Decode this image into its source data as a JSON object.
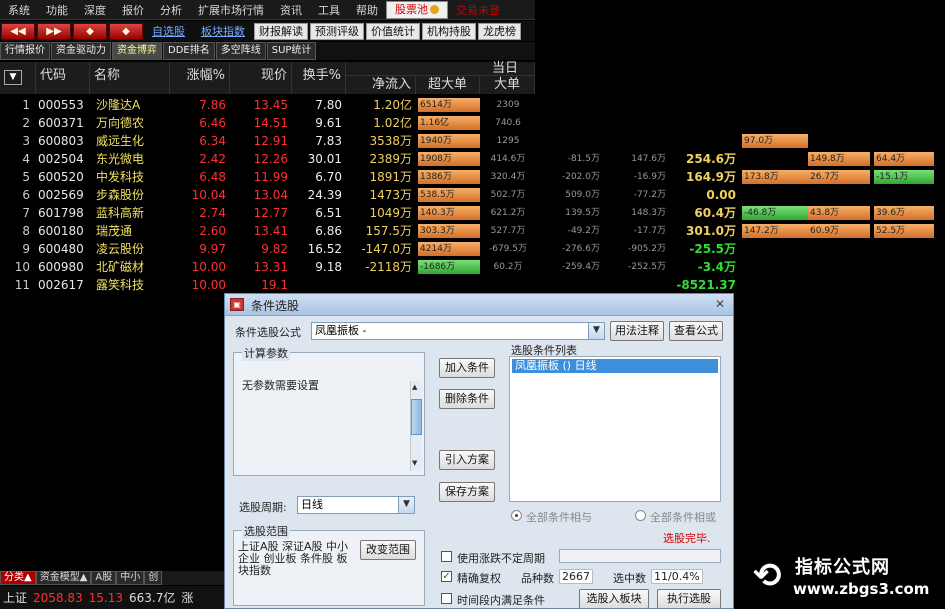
{
  "menubar": {
    "items": [
      "系统",
      "功能",
      "深度",
      "报价",
      "分析",
      "扩展市场行情",
      "资讯",
      "工具",
      "帮助"
    ],
    "highlight": "股票池",
    "extra": "交易未登"
  },
  "toolbar": {
    "nav": [
      "◀◀",
      "▶▶",
      "◆",
      "◆"
    ],
    "links": [
      "自选股",
      "板块指数"
    ],
    "boxes": [
      "财报解读",
      "预测评级",
      "价值统计",
      "机构持股",
      "龙虎榜"
    ]
  },
  "subtabs": [
    "行情报价",
    "资金驱动力",
    "资金博弈",
    "DDE排名",
    "多空阵线",
    "SUP统计"
  ],
  "subtab_active": 2,
  "table": {
    "headers": [
      "代码",
      "名称",
      "涨幅%",
      "现价",
      "换手%",
      "净流入",
      "超大单",
      "大单"
    ],
    "day_label": "当日",
    "rows": [
      {
        "n": "1",
        "code": "000553",
        "name": "沙隆达A",
        "chg": "7.86",
        "price": "13.45",
        "turn": "7.80",
        "net": "1.20亿",
        "b1": "6514万",
        "b2": "2309"
      },
      {
        "n": "2",
        "code": "600371",
        "name": "万向德农",
        "chg": "6.46",
        "price": "14.51",
        "turn": "9.61",
        "net": "1.02亿",
        "b1": "1.16亿",
        "b2": "740.6"
      },
      {
        "n": "3",
        "code": "600803",
        "name": "威远生化",
        "chg": "6.34",
        "price": "12.91",
        "turn": "7.83",
        "net": "3538万",
        "b1": "1940万",
        "b2": "1295"
      },
      {
        "n": "4",
        "code": "002504",
        "name": "东光微电",
        "chg": "2.42",
        "price": "12.26",
        "turn": "30.01",
        "net": "2389万",
        "b1": "1908万",
        "b2": "414.6万"
      },
      {
        "n": "5",
        "code": "600520",
        "name": "中发科技",
        "chg": "6.48",
        "price": "11.99",
        "turn": "6.70",
        "net": "1891万",
        "b1": "1386万",
        "b2": "320.4万"
      },
      {
        "n": "6",
        "code": "002569",
        "name": "步森股份",
        "chg": "10.04",
        "price": "13.04",
        "turn": "24.39",
        "net": "1473万",
        "b1": "538.5万",
        "b2": "502.7万"
      },
      {
        "n": "7",
        "code": "601798",
        "name": "蓝科高新",
        "chg": "2.74",
        "price": "12.77",
        "turn": "6.51",
        "net": "1049万",
        "b1": "140.3万",
        "b2": "621.2万"
      },
      {
        "n": "8",
        "code": "600180",
        "name": "瑞茂通",
        "chg": "2.60",
        "price": "13.41",
        "turn": "6.86",
        "net": "157.5万",
        "b1": "303.3万",
        "b2": "527.7万"
      },
      {
        "n": "9",
        "code": "600480",
        "name": "凌云股份",
        "chg": "9.97",
        "price": "9.82",
        "turn": "16.52",
        "net": "-147.0万",
        "b1": "4214万",
        "b2": "-679.5万"
      },
      {
        "n": "10",
        "code": "600980",
        "name": "北矿磁材",
        "chg": "10.00",
        "price": "13.31",
        "turn": "9.18",
        "net": "-2118万",
        "b1": "-1686万",
        "b2": "60.2万"
      },
      {
        "n": "11",
        "code": "002617",
        "name": "露笑科技",
        "chg": "10.00",
        "price": "19.1",
        "turn": "",
        "net": "",
        "b1": "",
        "b2": ""
      }
    ],
    "extra": [
      {
        "a": "",
        "b": "",
        "c": "",
        "d": "97.0万",
        "e": "",
        "f": ""
      },
      {
        "a": "-81.5万",
        "b": "147.6万",
        "c": "254.6万",
        "d": "",
        "e": "149.8万",
        "f": "64.4万"
      },
      {
        "a": "-202.0万",
        "b": "-16.9万",
        "c": "164.9万",
        "d": "173.8万",
        "e": "26.7万",
        "f": "-15.1万"
      },
      {
        "a": "509.0万",
        "b": "-77.2万",
        "c": "0.00",
        "d": "",
        "e": "",
        "f": ""
      },
      {
        "a": "139.5万",
        "b": "148.3万",
        "c": "60.4万",
        "d": "-46.8万",
        "e": "43.8万",
        "f": "39.6万"
      },
      {
        "a": "-49.2万",
        "b": "-17.7万",
        "c": "301.0万",
        "d": "147.2万",
        "e": "60.9万",
        "f": "52.5万"
      },
      {
        "a": "-276.6万",
        "b": "-905.2万",
        "c": "-25.5万",
        "d": "",
        "e": "",
        "f": ""
      },
      {
        "a": "-259.4万",
        "b": "-252.5万",
        "c": "-3.4万",
        "d": "",
        "e": "",
        "f": ""
      },
      {
        "a": "",
        "b": "",
        "c": "-8521.37",
        "d": "",
        "e": "",
        "f": ""
      }
    ]
  },
  "bottombar": {
    "tabs": [
      "分类▲",
      "资金模型▲",
      "A股",
      "中小",
      "创"
    ],
    "index_name": "上证",
    "index_value": "2058.83",
    "index_chg": "15.13",
    "amount": "663.7亿",
    "tail": "涨"
  },
  "dialog": {
    "title": "条件选股",
    "close": "✕",
    "formula_label": "条件选股公式",
    "formula_value": "凤凰振板 -",
    "usage_btn": "用法注释",
    "view_btn": "查看公式",
    "params_group": "计算参数",
    "params_text": "无参数需要设置",
    "add_btn": "加入条件",
    "del_btn": "删除条件",
    "import_btn": "引入方案",
    "save_btn": "保存方案",
    "list_label": "选股条件列表",
    "list_item": "凤凰振板 () 日线",
    "period_label": "选股周期:",
    "period_value": "日线",
    "radio_and": "全部条件相与",
    "radio_or": "全部条件相或",
    "done_text": "选股完毕.",
    "range_group": "选股范围",
    "range_text": "上证A股 深证A股 中小企业 创业板 条件股 板块指数",
    "change_range_btn": "改变范围",
    "chk_unfixed": "使用涨跌不定周期",
    "chk_adjust": "精确复权",
    "count_label": "品种数",
    "count_value": "2667",
    "selected_label": "选中数",
    "selected_value": "11/0.4%",
    "chk_period": "时间段内满足条件",
    "to_block_btn": "选股入板块",
    "exec_btn": "执行选股"
  },
  "watermark": {
    "line1": "指标公式网",
    "line2": "www.zbgs3.com"
  },
  "colors": {
    "up": "#ff3030",
    "down": "#30e030",
    "flat": "#ffffff",
    "code": "#e8e8e8",
    "name": "#f0e060"
  }
}
